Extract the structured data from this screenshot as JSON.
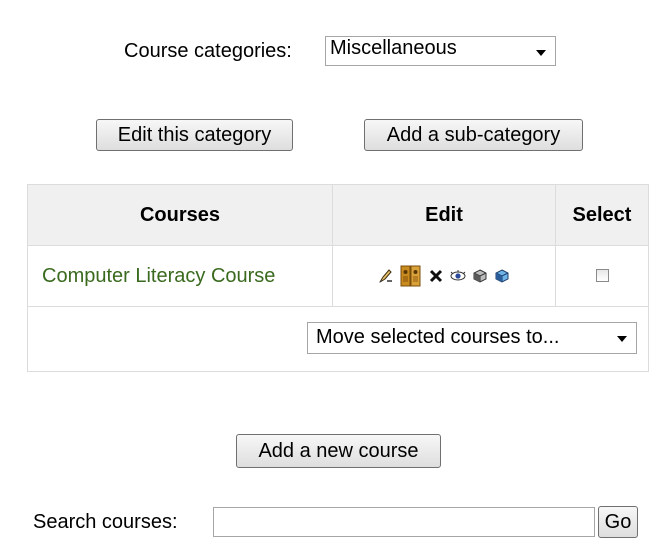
{
  "category": {
    "label": "Course categories:",
    "selected": "Miscellaneous"
  },
  "buttons": {
    "edit_category": "Edit this category",
    "add_subcategory": "Add a sub-category",
    "add_course": "Add a new course",
    "go": "Go"
  },
  "table": {
    "headers": [
      "Courses",
      "Edit",
      "Select"
    ],
    "rows": [
      {
        "course": "Computer Literacy Course",
        "edit_icons": [
          "edit-icon",
          "enrol-users-icon",
          "delete-icon",
          "hide-icon",
          "move-down-icon",
          "move-up-icon"
        ],
        "selected": false
      }
    ],
    "move_selected": "Move selected courses to..."
  },
  "search": {
    "label": "Search courses:",
    "value": ""
  },
  "colors": {
    "link": "#3a6a1e",
    "header_bg": "#f0f0f0",
    "border": "#dcdcdc"
  }
}
